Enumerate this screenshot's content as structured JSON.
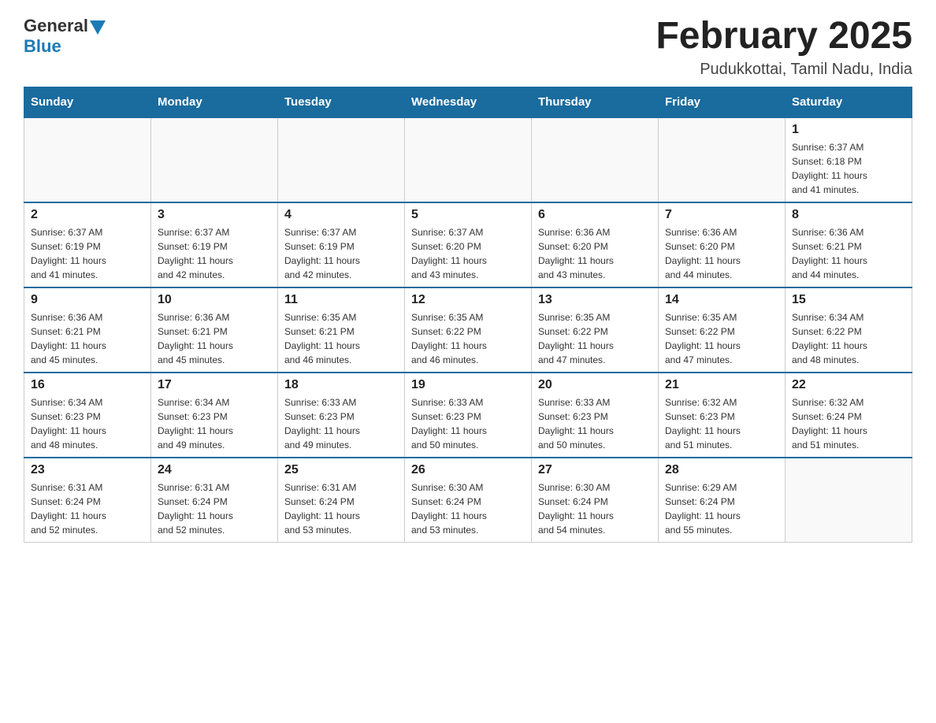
{
  "header": {
    "logo": {
      "text_general": "General",
      "text_blue": "Blue"
    },
    "title": "February 2025",
    "location": "Pudukkottai, Tamil Nadu, India"
  },
  "calendar": {
    "weekdays": [
      "Sunday",
      "Monday",
      "Tuesday",
      "Wednesday",
      "Thursday",
      "Friday",
      "Saturday"
    ],
    "weeks": [
      [
        {
          "day": "",
          "info": ""
        },
        {
          "day": "",
          "info": ""
        },
        {
          "day": "",
          "info": ""
        },
        {
          "day": "",
          "info": ""
        },
        {
          "day": "",
          "info": ""
        },
        {
          "day": "",
          "info": ""
        },
        {
          "day": "1",
          "info": "Sunrise: 6:37 AM\nSunset: 6:18 PM\nDaylight: 11 hours\nand 41 minutes."
        }
      ],
      [
        {
          "day": "2",
          "info": "Sunrise: 6:37 AM\nSunset: 6:19 PM\nDaylight: 11 hours\nand 41 minutes."
        },
        {
          "day": "3",
          "info": "Sunrise: 6:37 AM\nSunset: 6:19 PM\nDaylight: 11 hours\nand 42 minutes."
        },
        {
          "day": "4",
          "info": "Sunrise: 6:37 AM\nSunset: 6:19 PM\nDaylight: 11 hours\nand 42 minutes."
        },
        {
          "day": "5",
          "info": "Sunrise: 6:37 AM\nSunset: 6:20 PM\nDaylight: 11 hours\nand 43 minutes."
        },
        {
          "day": "6",
          "info": "Sunrise: 6:36 AM\nSunset: 6:20 PM\nDaylight: 11 hours\nand 43 minutes."
        },
        {
          "day": "7",
          "info": "Sunrise: 6:36 AM\nSunset: 6:20 PM\nDaylight: 11 hours\nand 44 minutes."
        },
        {
          "day": "8",
          "info": "Sunrise: 6:36 AM\nSunset: 6:21 PM\nDaylight: 11 hours\nand 44 minutes."
        }
      ],
      [
        {
          "day": "9",
          "info": "Sunrise: 6:36 AM\nSunset: 6:21 PM\nDaylight: 11 hours\nand 45 minutes."
        },
        {
          "day": "10",
          "info": "Sunrise: 6:36 AM\nSunset: 6:21 PM\nDaylight: 11 hours\nand 45 minutes."
        },
        {
          "day": "11",
          "info": "Sunrise: 6:35 AM\nSunset: 6:21 PM\nDaylight: 11 hours\nand 46 minutes."
        },
        {
          "day": "12",
          "info": "Sunrise: 6:35 AM\nSunset: 6:22 PM\nDaylight: 11 hours\nand 46 minutes."
        },
        {
          "day": "13",
          "info": "Sunrise: 6:35 AM\nSunset: 6:22 PM\nDaylight: 11 hours\nand 47 minutes."
        },
        {
          "day": "14",
          "info": "Sunrise: 6:35 AM\nSunset: 6:22 PM\nDaylight: 11 hours\nand 47 minutes."
        },
        {
          "day": "15",
          "info": "Sunrise: 6:34 AM\nSunset: 6:22 PM\nDaylight: 11 hours\nand 48 minutes."
        }
      ],
      [
        {
          "day": "16",
          "info": "Sunrise: 6:34 AM\nSunset: 6:23 PM\nDaylight: 11 hours\nand 48 minutes."
        },
        {
          "day": "17",
          "info": "Sunrise: 6:34 AM\nSunset: 6:23 PM\nDaylight: 11 hours\nand 49 minutes."
        },
        {
          "day": "18",
          "info": "Sunrise: 6:33 AM\nSunset: 6:23 PM\nDaylight: 11 hours\nand 49 minutes."
        },
        {
          "day": "19",
          "info": "Sunrise: 6:33 AM\nSunset: 6:23 PM\nDaylight: 11 hours\nand 50 minutes."
        },
        {
          "day": "20",
          "info": "Sunrise: 6:33 AM\nSunset: 6:23 PM\nDaylight: 11 hours\nand 50 minutes."
        },
        {
          "day": "21",
          "info": "Sunrise: 6:32 AM\nSunset: 6:23 PM\nDaylight: 11 hours\nand 51 minutes."
        },
        {
          "day": "22",
          "info": "Sunrise: 6:32 AM\nSunset: 6:24 PM\nDaylight: 11 hours\nand 51 minutes."
        }
      ],
      [
        {
          "day": "23",
          "info": "Sunrise: 6:31 AM\nSunset: 6:24 PM\nDaylight: 11 hours\nand 52 minutes."
        },
        {
          "day": "24",
          "info": "Sunrise: 6:31 AM\nSunset: 6:24 PM\nDaylight: 11 hours\nand 52 minutes."
        },
        {
          "day": "25",
          "info": "Sunrise: 6:31 AM\nSunset: 6:24 PM\nDaylight: 11 hours\nand 53 minutes."
        },
        {
          "day": "26",
          "info": "Sunrise: 6:30 AM\nSunset: 6:24 PM\nDaylight: 11 hours\nand 53 minutes."
        },
        {
          "day": "27",
          "info": "Sunrise: 6:30 AM\nSunset: 6:24 PM\nDaylight: 11 hours\nand 54 minutes."
        },
        {
          "day": "28",
          "info": "Sunrise: 6:29 AM\nSunset: 6:24 PM\nDaylight: 11 hours\nand 55 minutes."
        },
        {
          "day": "",
          "info": ""
        }
      ]
    ]
  }
}
